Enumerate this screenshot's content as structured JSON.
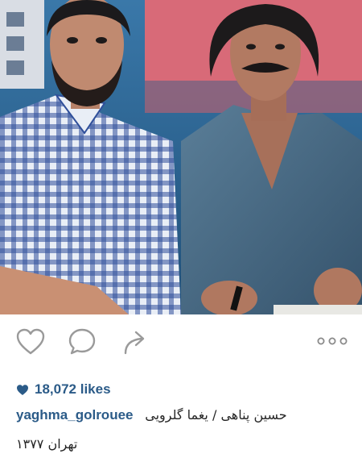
{
  "post": {
    "likes_count": "18,072 likes",
    "username": "yaghma_golrouee",
    "caption_line1": "حسین پناهی / یغما گلرویی",
    "caption_line2": "تهران ۱۳۷۷"
  },
  "actions": {
    "like_icon": "heart-outline-icon",
    "comment_icon": "speech-bubble-icon",
    "share_icon": "share-arrow-icon",
    "more_icon": "three-dots-icon"
  },
  "colors": {
    "link_blue": "#2b5b88",
    "icon_gray": "#9a9a9a",
    "text": "#262626"
  }
}
